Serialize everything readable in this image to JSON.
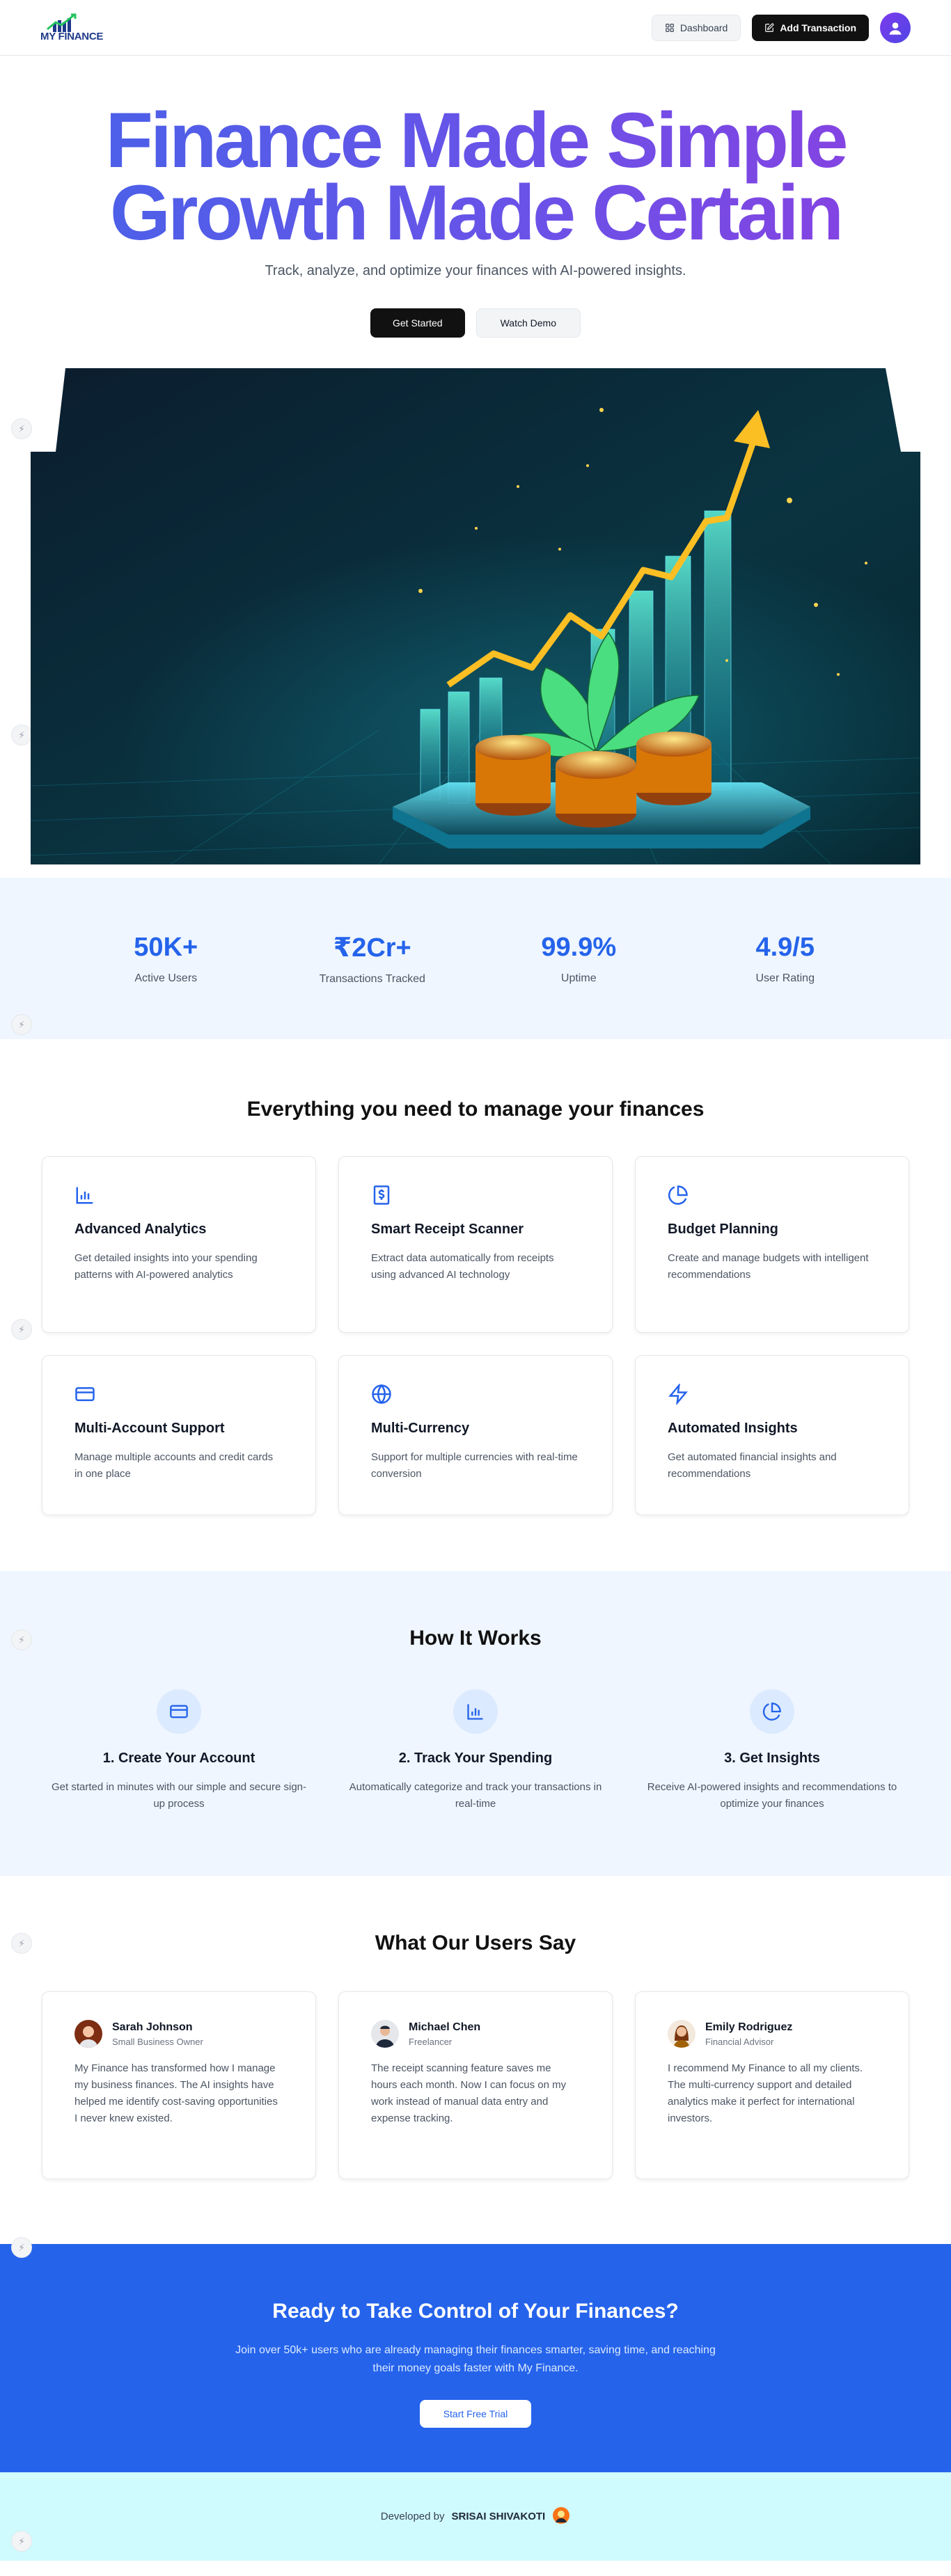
{
  "header": {
    "logo_text": "MY FINANCE",
    "dashboard_label": "Dashboard",
    "add_transaction_label": "Add Transaction"
  },
  "hero": {
    "title_line1": "Finance Made Simple",
    "title_line2": "Growth Made Certain",
    "subtitle": "Track, analyze, and optimize your finances with AI-powered insights.",
    "primary_cta": "Get Started",
    "secondary_cta": "Watch Demo"
  },
  "stats": [
    {
      "value": "50K+",
      "label": "Active Users"
    },
    {
      "value": "₹2Cr+",
      "label": "Transactions Tracked"
    },
    {
      "value": "99.9%",
      "label": "Uptime"
    },
    {
      "value": "4.9/5",
      "label": "User Rating"
    }
  ],
  "features": {
    "title": "Everything you need to manage your finances",
    "items": [
      {
        "icon": "bar-chart-icon",
        "title": "Advanced Analytics",
        "desc": "Get detailed insights into your spending patterns with AI-powered analytics"
      },
      {
        "icon": "receipt-icon",
        "title": "Smart Receipt Scanner",
        "desc": "Extract data automatically from receipts using advanced AI technology"
      },
      {
        "icon": "pie-chart-icon",
        "title": "Budget Planning",
        "desc": "Create and manage budgets with intelligent recommendations"
      },
      {
        "icon": "credit-card-icon",
        "title": "Multi-Account Support",
        "desc": "Manage multiple accounts and credit cards in one place"
      },
      {
        "icon": "globe-icon",
        "title": "Multi-Currency",
        "desc": "Support for multiple currencies with real-time conversion"
      },
      {
        "icon": "zap-icon",
        "title": "Automated Insights",
        "desc": "Get automated financial insights and recommendations"
      }
    ]
  },
  "how": {
    "title": "How It Works",
    "steps": [
      {
        "icon": "credit-card-icon",
        "title": "1. Create Your Account",
        "desc": "Get started in minutes with our simple and secure sign-up process"
      },
      {
        "icon": "bar-chart-icon",
        "title": "2. Track Your Spending",
        "desc": "Automatically categorize and track your transactions in real-time"
      },
      {
        "icon": "pie-chart-icon",
        "title": "3. Get Insights",
        "desc": "Receive AI-powered insights and recommendations to optimize your finances"
      }
    ]
  },
  "testimonials": {
    "title": "What Our Users Say",
    "items": [
      {
        "name": "Sarah Johnson",
        "role": "Small Business Owner",
        "quote": "My Finance has transformed how I manage my business finances. The AI insights have helped me identify cost-saving opportunities I never knew existed."
      },
      {
        "name": "Michael Chen",
        "role": "Freelancer",
        "quote": "The receipt scanning feature saves me hours each month. Now I can focus on my work instead of manual data entry and expense tracking."
      },
      {
        "name": "Emily Rodriguez",
        "role": "Financial Advisor",
        "quote": "I recommend My Finance to all my clients. The multi-currency support and detailed analytics make it perfect for international investors."
      }
    ]
  },
  "cta": {
    "title": "Ready to Take Control of Your Finances?",
    "desc": "Join over 50k+ users who are already managing their finances smarter, saving time, and reaching their money goals faster with My Finance.",
    "button": "Start Free Trial"
  },
  "footer": {
    "prefix": "Developed by",
    "author": "SRISAI SHIVAKOTI"
  },
  "colors": {
    "accent": "#2563eb",
    "section_tint": "#eff6ff",
    "footer_bg": "#cffafe"
  }
}
